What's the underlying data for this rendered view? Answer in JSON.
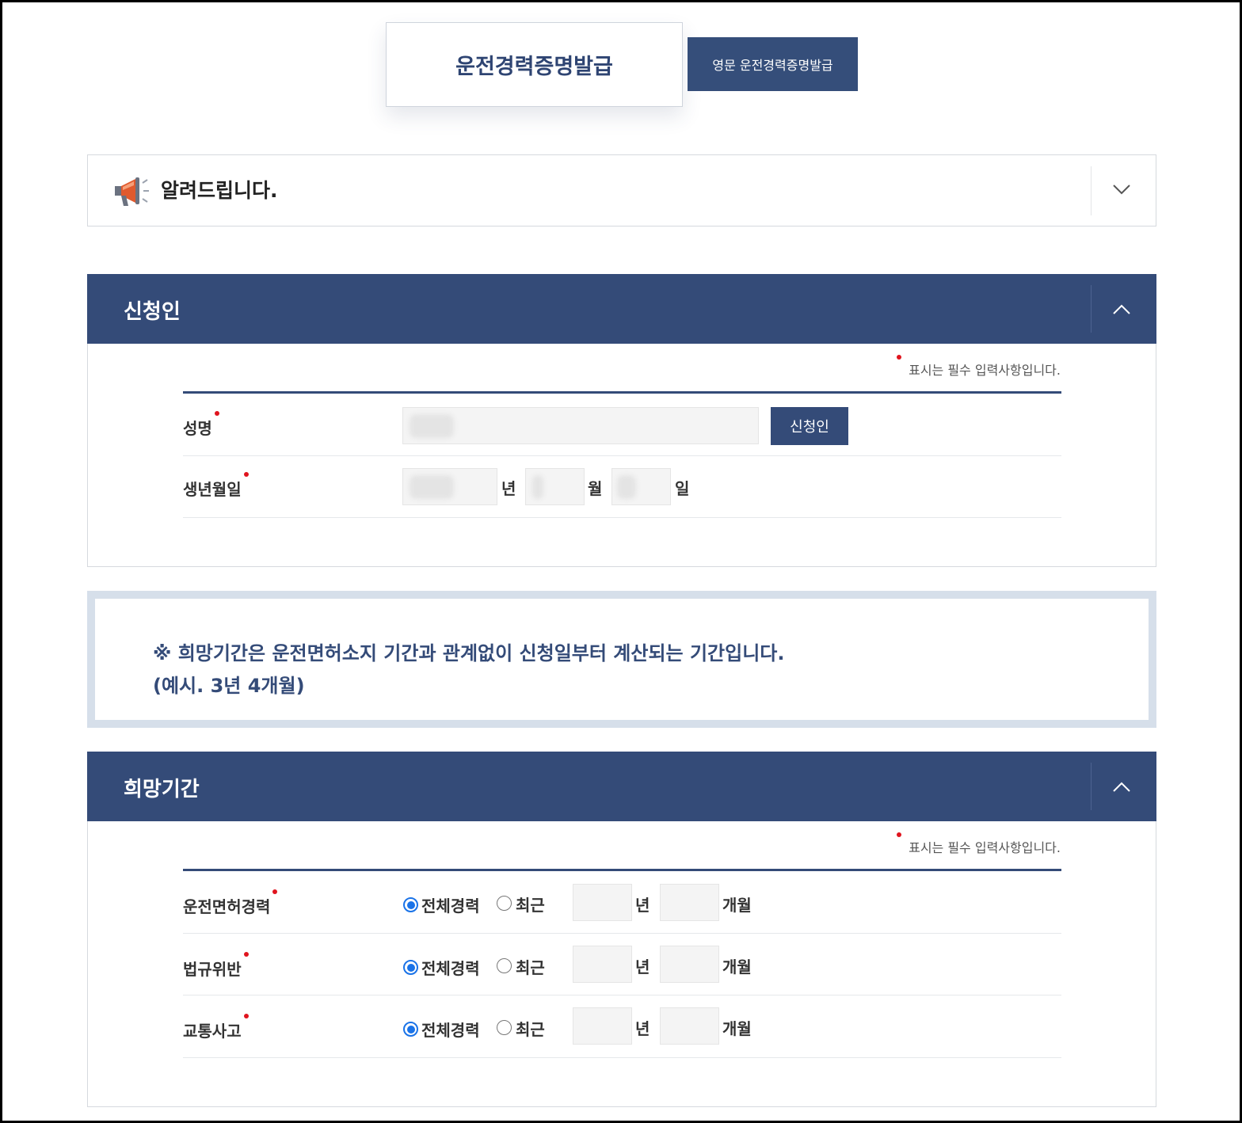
{
  "tabs": {
    "active": "운전경력증명발급",
    "english": "영문 운전경력증명발급"
  },
  "notice": {
    "title": "알려드립니다.",
    "icon": "megaphone-icon",
    "toggle_icon": "chevron-down-icon"
  },
  "applicant_section": {
    "title": "신청인",
    "toggle_icon": "chevron-up-icon",
    "required_note": "표시는 필수 입력사항입니다.",
    "name_label": "성명",
    "name_button": "신청인",
    "birth_label": "생년월일",
    "year_unit": "년",
    "month_unit": "월",
    "day_unit": "일"
  },
  "info": {
    "line1": "※ 희망기간은 운전면허소지 기간과 관계없이 신청일부터 계산되는 기간입니다.",
    "line2": "(예시. 3년 4개월)"
  },
  "period_section": {
    "title": "희망기간",
    "toggle_icon": "chevron-up-icon",
    "required_note": "표시는 필수 입력사항입니다.",
    "rows": [
      {
        "label": "운전면허경력",
        "opt_all": "전체경력",
        "opt_recent": "최근",
        "year_unit": "년",
        "month_unit": "개월",
        "selected": "전체경력"
      },
      {
        "label": "법규위반",
        "opt_all": "전체경력",
        "opt_recent": "최근",
        "year_unit": "년",
        "month_unit": "개월",
        "selected": "전체경력"
      },
      {
        "label": "교통사고",
        "opt_all": "전체경력",
        "opt_recent": "최근",
        "year_unit": "년",
        "month_unit": "개월",
        "selected": "전체경력"
      }
    ]
  },
  "colors": {
    "navy": "#344b78",
    "required_dot": "#e0141e",
    "info_border": "#d6dfea",
    "radio_selected": "#1a73e8"
  }
}
